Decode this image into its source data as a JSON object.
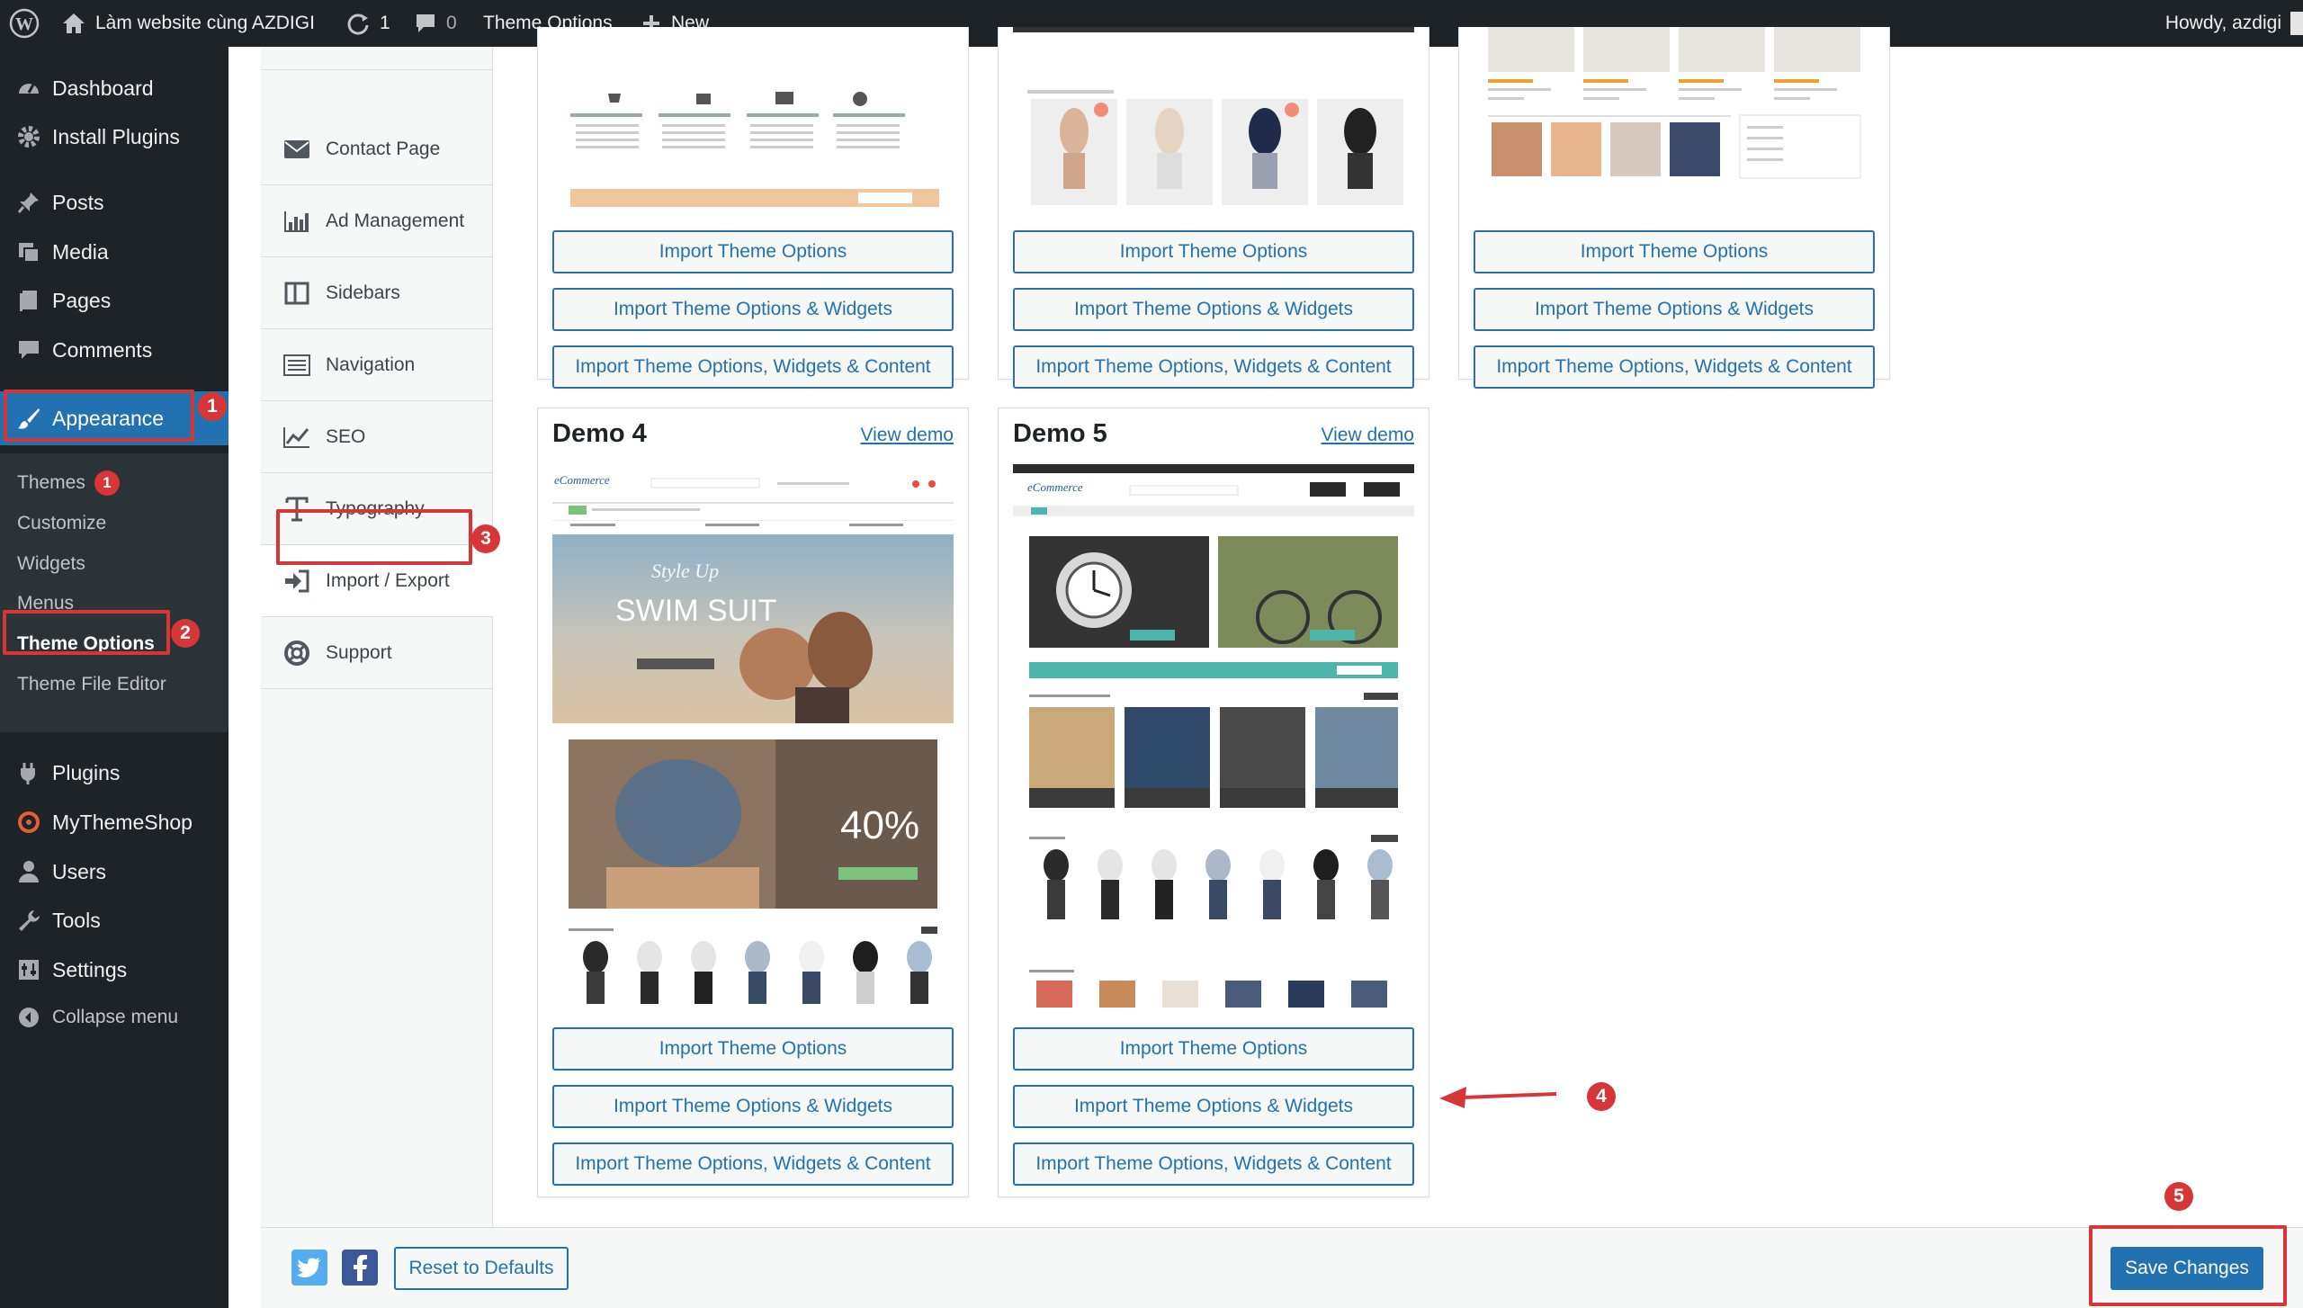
{
  "colors": {
    "admin_dark": "#1d2327",
    "accent": "#2271b1",
    "annotation": "#d63638"
  },
  "adminbar": {
    "site_name": "Làm website cùng AZDIGI",
    "updates_count": "1",
    "comments_count": "0",
    "theme_options": "Theme Options",
    "new": "New",
    "howdy": "Howdy, azdigi"
  },
  "sidebar": {
    "items": [
      {
        "label": "Dashboard",
        "icon": "dashboard-icon"
      },
      {
        "label": "Install Plugins",
        "icon": "gear-icon"
      },
      {
        "label": "Posts",
        "icon": "pin-icon"
      },
      {
        "label": "Media",
        "icon": "media-icon"
      },
      {
        "label": "Pages",
        "icon": "pages-icon"
      },
      {
        "label": "Comments",
        "icon": "comment-icon"
      },
      {
        "label": "Appearance",
        "icon": "brush-icon"
      },
      {
        "label": "Plugins",
        "icon": "plug-icon"
      },
      {
        "label": "MyThemeShop",
        "icon": "mythemeshop-icon"
      },
      {
        "label": "Users",
        "icon": "user-icon"
      },
      {
        "label": "Tools",
        "icon": "wrench-icon"
      },
      {
        "label": "Settings",
        "icon": "settings-icon"
      },
      {
        "label": "Collapse menu",
        "icon": "collapse-icon"
      }
    ],
    "submenu": [
      {
        "label": "Themes",
        "badge": "1"
      },
      {
        "label": "Customize"
      },
      {
        "label": "Widgets"
      },
      {
        "label": "Menus"
      },
      {
        "label": "Theme Options"
      },
      {
        "label": "Theme File Editor"
      }
    ]
  },
  "settings_nav": [
    {
      "label": "Contact Page",
      "icon": "envelope-icon"
    },
    {
      "label": "Ad Management",
      "icon": "bar-chart-icon"
    },
    {
      "label": "Sidebars",
      "icon": "columns-icon"
    },
    {
      "label": "Navigation",
      "icon": "list-icon"
    },
    {
      "label": "SEO",
      "icon": "line-chart-icon"
    },
    {
      "label": "Typography",
      "icon": "text-icon"
    },
    {
      "label": "Import / Export",
      "icon": "sign-in-icon"
    },
    {
      "label": "Support",
      "icon": "lifebuoy-icon"
    }
  ],
  "buttons": {
    "import_options": "Import Theme Options",
    "import_widgets": "Import Theme Options & Widgets",
    "import_content": "Import Theme Options, Widgets & Content"
  },
  "demos": [
    {
      "title": "Demo 4",
      "view": "View demo",
      "banner_text": "SWIM SUIT",
      "promo_text": "40%"
    },
    {
      "title": "Demo 5",
      "view": "View demo"
    }
  ],
  "footer": {
    "reset": "Reset to Defaults",
    "save": "Save Changes"
  },
  "annotations": [
    "1",
    "2",
    "3",
    "4",
    "5"
  ]
}
